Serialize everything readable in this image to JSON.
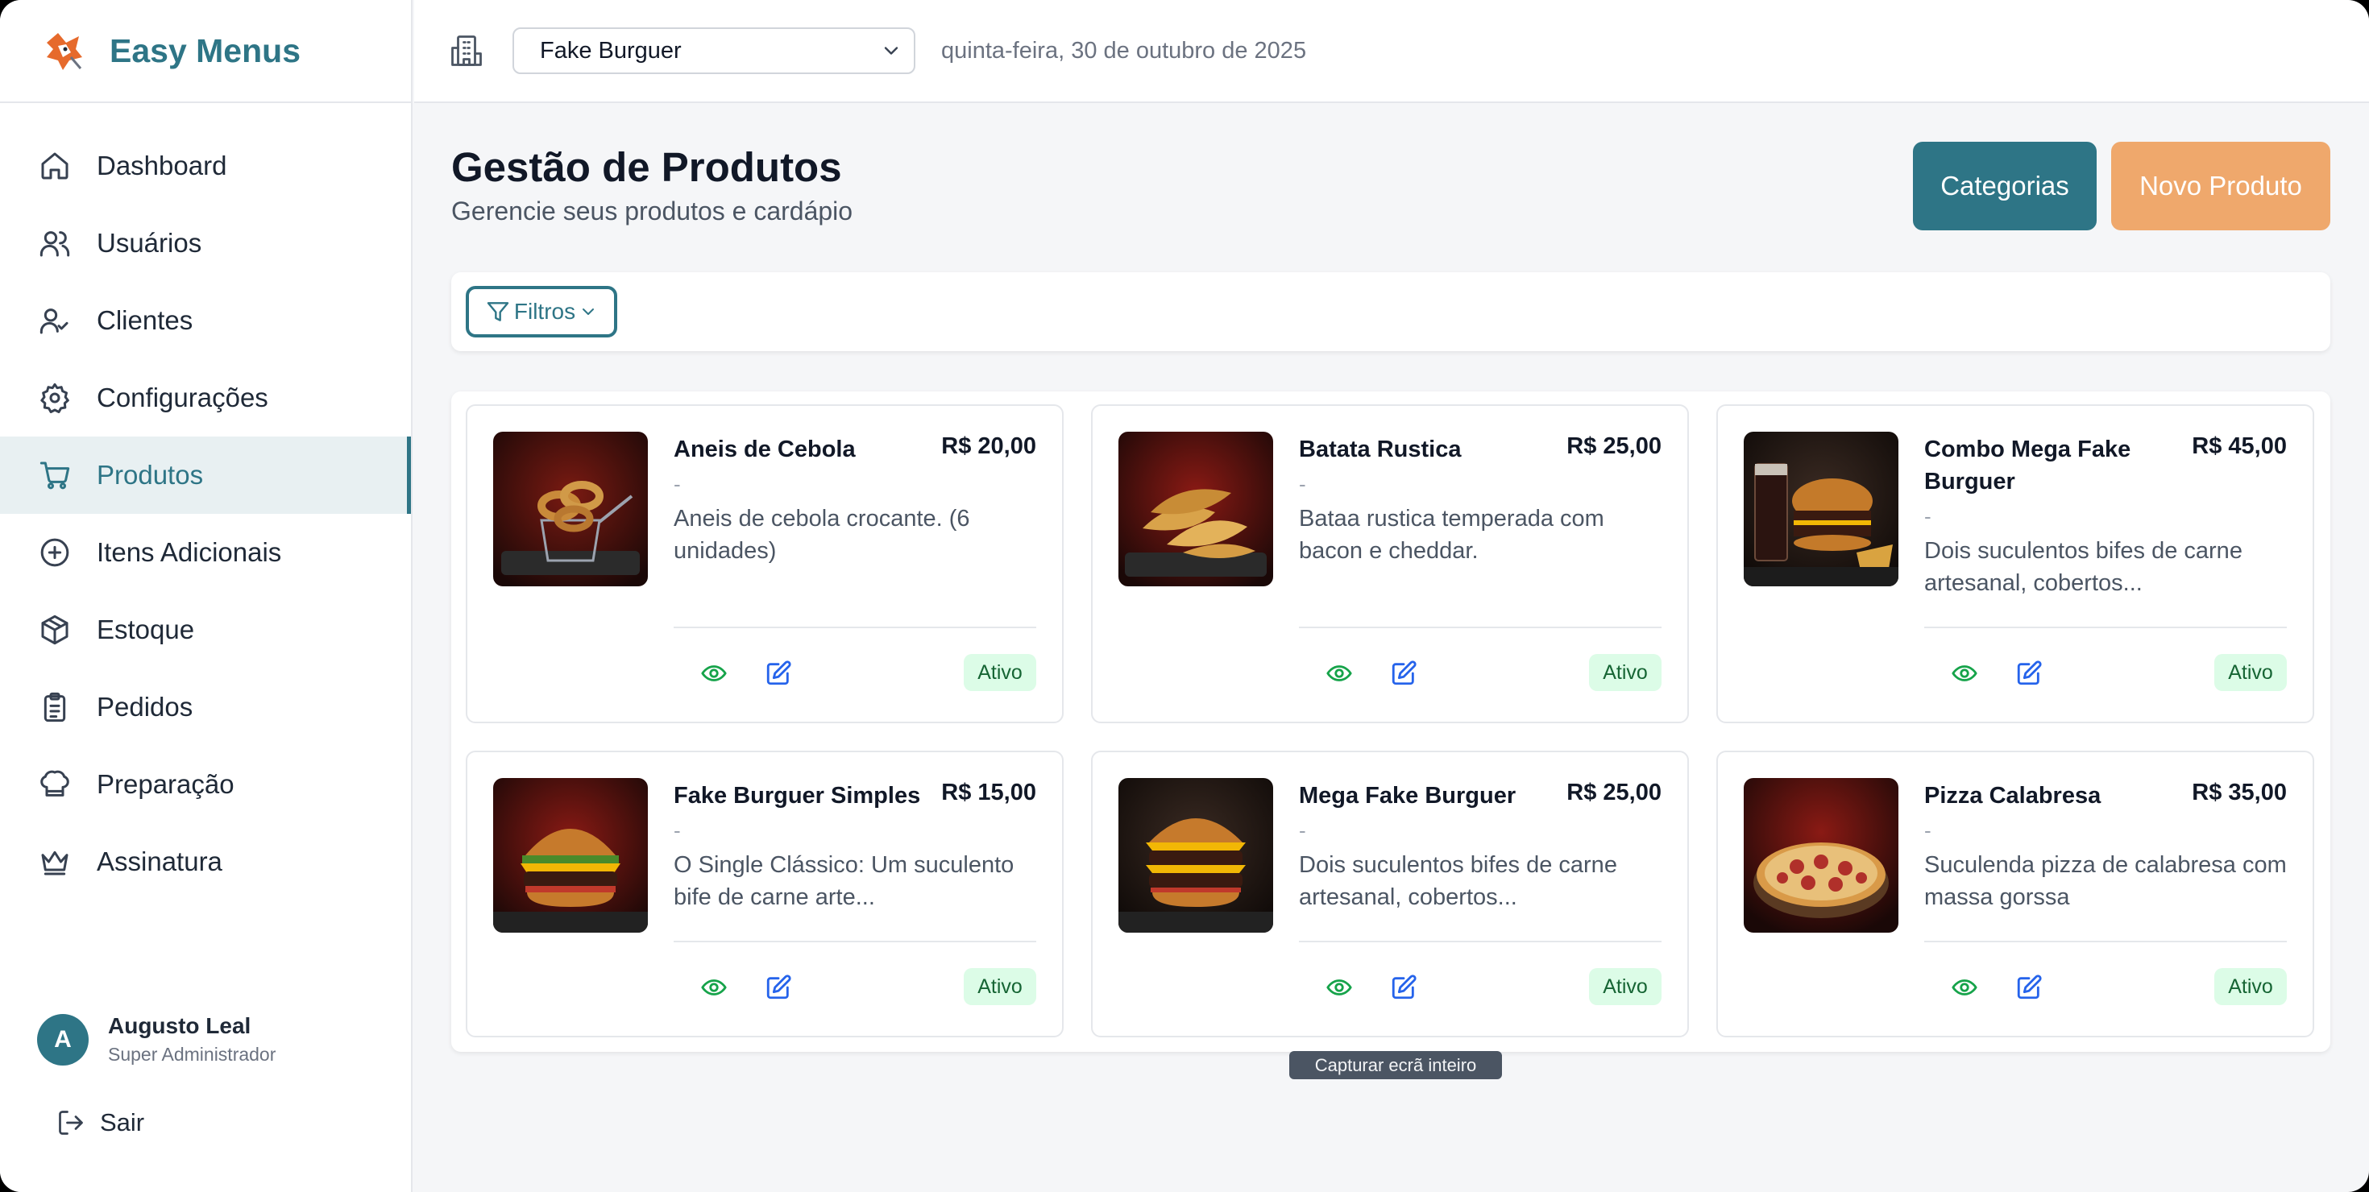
{
  "brand": {
    "name": "Easy Menus"
  },
  "sidebar": {
    "items": [
      {
        "label": "Dashboard",
        "icon": "home-icon"
      },
      {
        "label": "Usuários",
        "icon": "users-icon"
      },
      {
        "label": "Clientes",
        "icon": "user-check-icon"
      },
      {
        "label": "Configurações",
        "icon": "gear-icon"
      },
      {
        "label": "Produtos",
        "icon": "cart-icon",
        "active": true
      },
      {
        "label": "Itens Adicionais",
        "icon": "plus-circle-icon"
      },
      {
        "label": "Estoque",
        "icon": "package-icon"
      },
      {
        "label": "Pedidos",
        "icon": "clipboard-icon"
      },
      {
        "label": "Preparação",
        "icon": "chef-hat-icon"
      },
      {
        "label": "Assinatura",
        "icon": "crown-icon"
      }
    ],
    "user": {
      "initial": "A",
      "name": "Augusto Leal",
      "role": "Super Administrador"
    },
    "logout_label": "Sair"
  },
  "topbar": {
    "store_selected": "Fake Burguer",
    "date": "quinta-feira, 30 de outubro de 2025"
  },
  "main": {
    "title": "Gestão de Produtos",
    "subtitle": "Gerencie seus produtos e cardápio",
    "categories_button": "Categorias",
    "new_product_button": "Novo Produto",
    "filters_button": "Filtros"
  },
  "products": [
    {
      "name": "Aneis de Cebola",
      "price": "R$ 20,00",
      "dash": "-",
      "description": "Aneis de cebola crocante. (6 unidades)",
      "status": "Ativo",
      "image": "onion-rings"
    },
    {
      "name": "Batata Rustica",
      "price": "R$ 25,00",
      "dash": "-",
      "description": "Bataa rustica temperada com bacon e cheddar.",
      "status": "Ativo",
      "image": "potato-wedges"
    },
    {
      "name": "Combo Mega Fake Burguer",
      "price": "R$ 45,00",
      "dash": "-",
      "description": "Dois suculentos bifes de carne artesanal, cobertos...",
      "status": "Ativo",
      "image": "combo"
    },
    {
      "name": "Fake Burguer Simples",
      "price": "R$ 15,00",
      "dash": "-",
      "description": "O Single Clássico: Um suculento bife de carne arte...",
      "status": "Ativo",
      "image": "burger"
    },
    {
      "name": "Mega Fake Burguer",
      "price": "R$ 25,00",
      "dash": "-",
      "description": "Dois suculentos bifes de carne artesanal, cobertos...",
      "status": "Ativo",
      "image": "double-burger"
    },
    {
      "name": "Pizza Calabresa",
      "price": "R$ 35,00",
      "dash": "-",
      "description": "Suculenda pizza de calabresa com massa gorssa",
      "status": "Ativo",
      "image": "pizza"
    }
  ],
  "tooltip": "Capturar ecrã inteiro",
  "colors": {
    "primary": "#2e7586",
    "accent": "#efa86c",
    "badge_bg": "#dcfce7",
    "badge_text": "#166534"
  }
}
